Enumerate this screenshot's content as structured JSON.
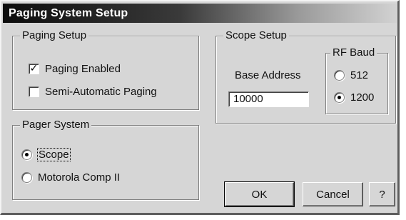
{
  "window": {
    "title": "Paging System Setup"
  },
  "paging_setup": {
    "legend": "Paging Setup",
    "paging_enabled": {
      "label": "Paging Enabled",
      "checked": true
    },
    "semi_automatic": {
      "label": "Semi-Automatic Paging",
      "checked": false
    }
  },
  "pager_system": {
    "legend": "Pager System",
    "options": [
      {
        "label": "Scope",
        "selected": true
      },
      {
        "label": "Motorola Comp II",
        "selected": false
      }
    ]
  },
  "scope_setup": {
    "legend": "Scope Setup",
    "base_address_label": "Base Address",
    "base_address_value": "10000",
    "rf_baud": {
      "legend": "RF Baud",
      "options": [
        {
          "label": "512",
          "selected": false
        },
        {
          "label": "1200",
          "selected": true
        }
      ]
    }
  },
  "buttons": {
    "ok": "OK",
    "cancel": "Cancel",
    "help": "?"
  }
}
